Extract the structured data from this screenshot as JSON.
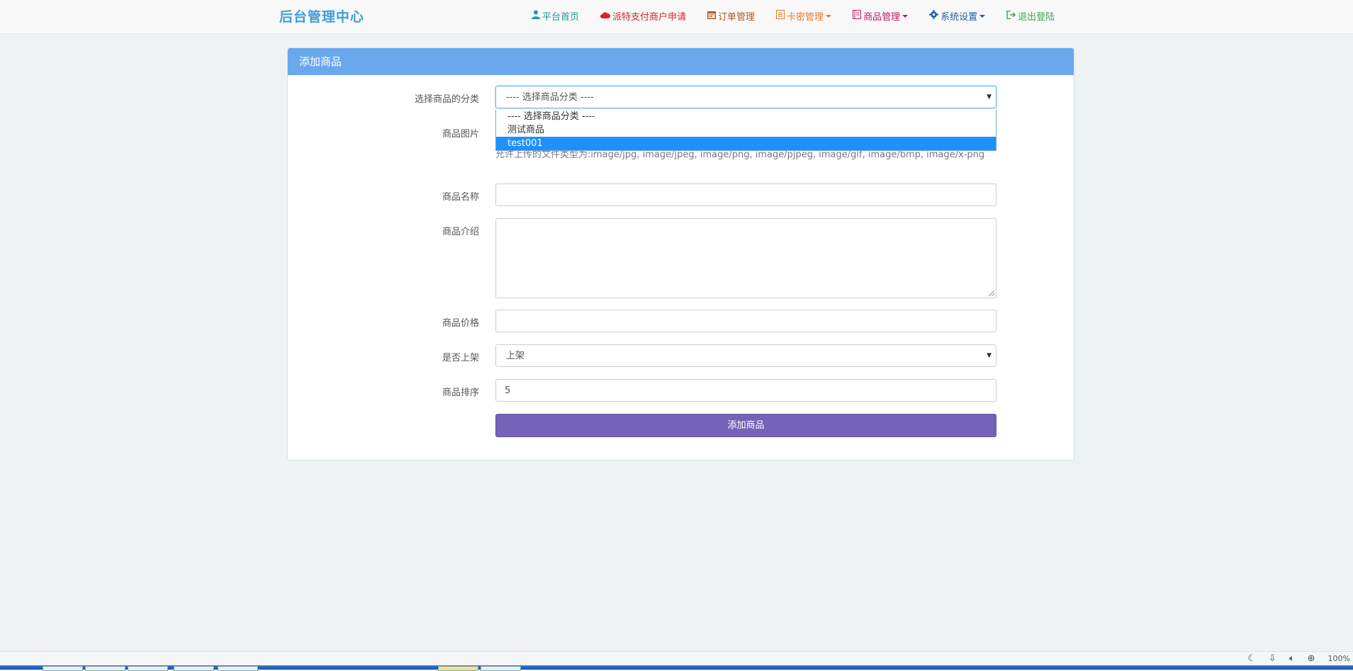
{
  "navbar": {
    "brand": "后台管理中心",
    "items": [
      {
        "label": "平台首页",
        "icon": "user-icon",
        "color": "#1e9a9a"
      },
      {
        "label": "派特支付商户申请",
        "icon": "cloud-icon",
        "color": "#d9232d"
      },
      {
        "label": "订单管理",
        "icon": "calendar-icon",
        "color": "#b05a1c"
      },
      {
        "label": "卡密管理",
        "icon": "list-icon",
        "color": "#e87a2a"
      },
      {
        "label": "商品管理",
        "icon": "book-icon",
        "color": "#c2186d"
      },
      {
        "label": "系统设置",
        "icon": "gear-icon",
        "color": "#1f5fa6"
      },
      {
        "label": "退出登陆",
        "icon": "logout-icon",
        "color": "#3aa84a"
      }
    ]
  },
  "panel": {
    "title": "添加商品"
  },
  "form": {
    "category_label": "选择商品的分类",
    "category_value": "---- 选择商品分类 ----",
    "category_options": [
      "---- 选择商品分类 ----",
      "测试商品",
      "test001"
    ],
    "image_label": "商品图片",
    "image_hint": "允许上传的文件类型为:image/jpg, image/jpeg, image/png, image/pjpeg, image/gif, image/bmp, image/x-png",
    "name_label": "商品名称",
    "name_value": "",
    "desc_label": "商品介绍",
    "desc_value": "",
    "price_label": "商品价格",
    "price_value": "",
    "onsale_label": "是否上架",
    "onsale_value": "上架",
    "sort_label": "商品排序",
    "sort_value": "5",
    "submit_label": "添加商品"
  },
  "statusbar": {
    "zoom": "100%"
  }
}
